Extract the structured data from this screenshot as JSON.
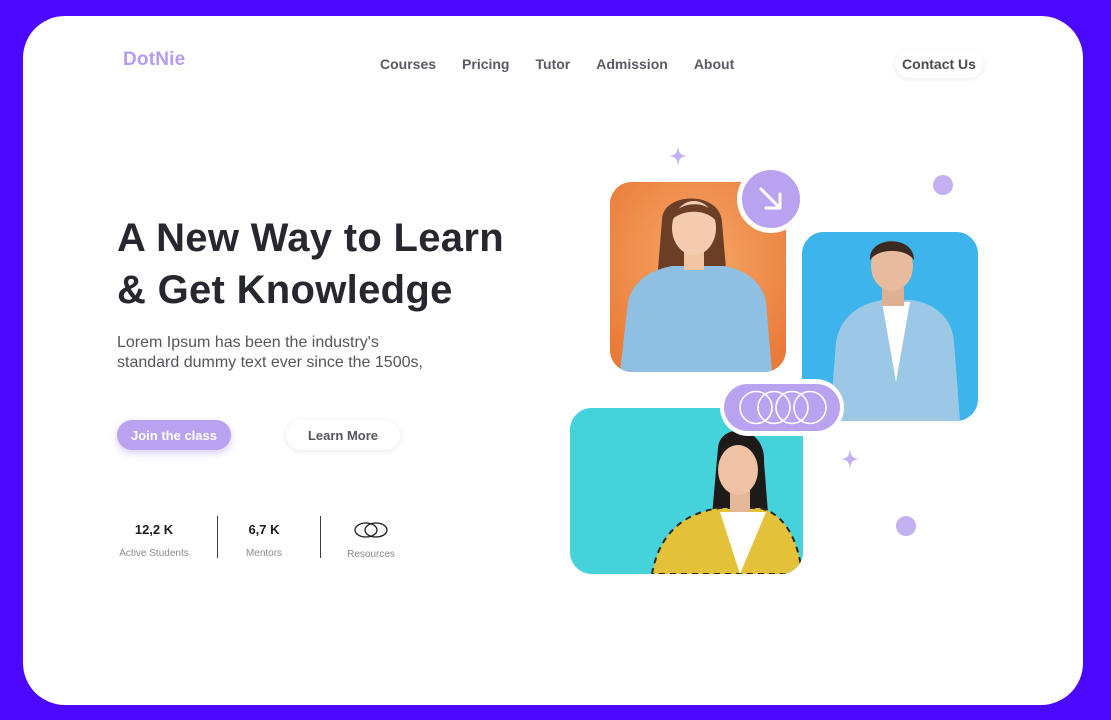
{
  "brand": {
    "logo": "DotNie"
  },
  "nav": {
    "items": [
      "Courses",
      "Pricing",
      "Tutor",
      "Admission",
      "About"
    ]
  },
  "header": {
    "contact_label": "Contact Us"
  },
  "hero": {
    "title_line1": "A New Way to Learn",
    "title_line2": "& Get Knowledge",
    "subtitle_line1": "Lorem Ipsum has been the industry's",
    "subtitle_line2": "standard dummy text ever since the 1500s,",
    "primary_cta": "Join the class",
    "secondary_cta": "Learn More"
  },
  "stats": [
    {
      "value": "12,2 K",
      "label": "Active Students"
    },
    {
      "value": "6,7 K",
      "label": "Mentors"
    },
    {
      "value": "",
      "label": "Resources",
      "icon": "linked-rings-icon"
    }
  ],
  "colors": {
    "frame": "#4B08FF",
    "accent": "#B9A3F0",
    "photo_orange": "#EF8A48",
    "photo_blue": "#3DB5EC",
    "photo_teal": "#45D2DA"
  },
  "icons": [
    "arrow-down-right-icon",
    "linked-rings-icon",
    "sparkle-icon"
  ]
}
